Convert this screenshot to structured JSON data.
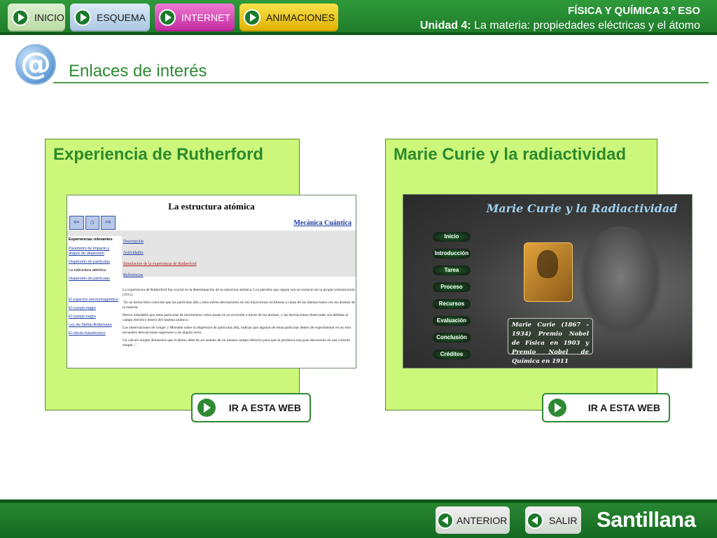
{
  "nav": {
    "inicio": "INICIO",
    "esquema": "ESQUEMA",
    "internet": "INTERNET",
    "animaciones": "ANIMACIONES"
  },
  "course": {
    "subject": "FÍSICA Y QUÍMICA 3.º ESO",
    "unit_prefix": "Unidad 4:",
    "unit_title": "La materia: propiedades eléctricas y el átomo"
  },
  "header": {
    "logo_glyph": "@",
    "title": "Enlaces de interés"
  },
  "cards": [
    {
      "title": "Experiencia de Rutherford",
      "button_label": "IR A ESTA WEB",
      "preview": {
        "page_title": "La estructura atómica",
        "header_link": "Mecánica Cuántica",
        "tools": [
          "⇦",
          "⌂",
          "⇨"
        ],
        "side_heading": "Experiencias relevantes",
        "side_links": [
          "Parámetro de impacto y ángulo de dispersión",
          "Dispersión de partículas",
          "La estructura atómica",
          "Dispersión de partículas",
          "El espectro electromagnético",
          "El cuerpo negro",
          "El cuerpo negro",
          "Ley de Stefan-Boltzmann",
          "El efecto fotoeléctrico"
        ],
        "menu": [
          "Descripción",
          "Actividades",
          "Simulación de la experiencia de Rutherford",
          "Referencias"
        ],
        "body": [
          "La experiencia de Rutherford fue crucial en la determinación de la estructura atómica. Los párrafos que siguen son un extracto de su propia comunicación (1911).",
          "\"Es un hecho bien conocido que las partículas alfa y beta sufren desviaciones de sus trayectorias rectilíneas a causa de las interacciones con los átomos de la materia.",
          "Parece indudable que estas partículas de movimiento veloz pasan en su recorrido a través de los átomos, y las desviaciones observadas son debidas al campo eléctrico dentro del sistema atómico.",
          "Las observaciones de Geiger y Marsden sobre la dispersión de partículas alfa, indican que algunas de estas partículas deben de experimentar en un solo encuentro desviaciones superiores a un ángulo recto.",
          "Un cálculo simple demuestra que el átomo debe de ser asiento de un intenso campo eléctrico para que se produzca una gran desviación en una colisión simple...\""
        ]
      }
    },
    {
      "title": "Marie Curie y la radiactividad",
      "button_label": "IR A ESTA WEB",
      "preview": {
        "page_title": "Marie Curie y la Radiactividad",
        "menu": [
          "Inicio",
          "Introducción",
          "Tarea",
          "Proceso",
          "Recursos",
          "Evaluación",
          "Conclusión",
          "Créditos"
        ],
        "caption": "Marie Curie (1867 - 1934) Premio Nobel de Física en 1903 y Premio Nobel de Química en 1911"
      }
    }
  ],
  "footer": {
    "anterior": "ANTERIOR",
    "salir": "SALIR",
    "brand": "Santillana"
  },
  "colors": {
    "accent_green": "#2f8a33",
    "card_background": "#ccf77a",
    "internet_tab": "#c0289f",
    "animaciones_tab": "#e0b000"
  }
}
